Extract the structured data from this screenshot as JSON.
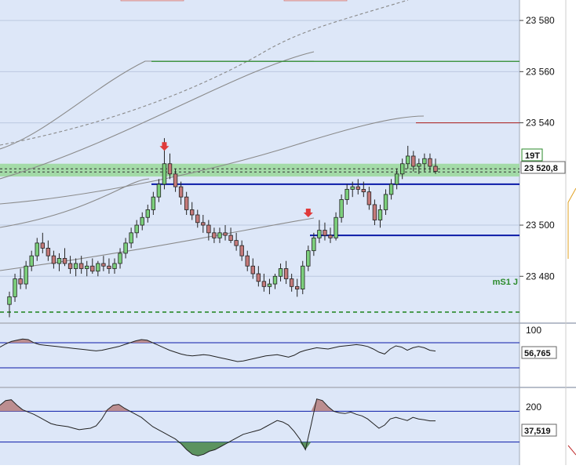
{
  "colors": {
    "pane_bg": "#dde7f8",
    "axis_bg": "#ffffff",
    "grid": "#bcc8e0",
    "candle_up": "#7ccf7c",
    "candle_down": "#c47a7a",
    "level_blue": "#0a1aa8",
    "zone_green": "#9ad89a",
    "indicator_line": "#222222",
    "indicator_fill": "#b88484",
    "indicator_fill_low": "#4e8a4e",
    "marker_red": "#e03a3a",
    "level_dkgreen": "#2a8a2a",
    "resistance_red": "#b03030"
  },
  "main_axis": {
    "ticks": [
      "23 580",
      "23 560",
      "23 540",
      "23 500",
      "23 480"
    ]
  },
  "labels": {
    "price_box": "23 520,8",
    "period_box": "19T",
    "level_tag": "mS1 J"
  },
  "rsi_axis": {
    "tick": "100",
    "value_box": "56,765"
  },
  "cci_axis": {
    "tick": "200",
    "value_box": "37,519"
  },
  "chart_data": [
    {
      "type": "candlestick",
      "ylim": [
        23462,
        23588
      ],
      "yticks": [
        23580,
        23560,
        23540,
        23500,
        23480
      ],
      "grid": true,
      "last_price": 23520.8,
      "levels": [
        {
          "value": 23516,
          "color": "level_blue"
        },
        {
          "value": 23496,
          "color": "level_blue"
        },
        {
          "value": 23466,
          "color": "level_dkgreen",
          "style": "dashed"
        },
        {
          "value": 23540,
          "color": "resistance_red"
        },
        {
          "value": 23564,
          "color": "level_dkgreen"
        }
      ],
      "zone": [
        23519,
        23524
      ],
      "candles": [
        [
          23469,
          23474,
          23464,
          23472
        ],
        [
          23472,
          23481,
          23470,
          23479
        ],
        [
          23479,
          23483,
          23475,
          23477
        ],
        [
          23477,
          23486,
          23475,
          23484
        ],
        [
          23484,
          23490,
          23482,
          23488
        ],
        [
          23488,
          23495,
          23486,
          23493
        ],
        [
          23493,
          23497,
          23489,
          23491
        ],
        [
          23491,
          23494,
          23486,
          23488
        ],
        [
          23488,
          23490,
          23483,
          23485
        ],
        [
          23485,
          23489,
          23482,
          23487
        ],
        [
          23487,
          23491,
          23484,
          23485
        ],
        [
          23485,
          23488,
          23481,
          23483
        ],
        [
          23483,
          23487,
          23480,
          23485
        ],
        [
          23485,
          23488,
          23481,
          23483
        ],
        [
          23483,
          23486,
          23480,
          23484
        ],
        [
          23484,
          23487,
          23481,
          23482
        ],
        [
          23482,
          23486,
          23480,
          23485
        ],
        [
          23485,
          23488,
          23482,
          23484
        ],
        [
          23484,
          23487,
          23481,
          23483
        ],
        [
          23483,
          23487,
          23481,
          23485
        ],
        [
          23485,
          23491,
          23483,
          23489
        ],
        [
          23489,
          23495,
          23487,
          23493
        ],
        [
          23493,
          23499,
          23491,
          23497
        ],
        [
          23497,
          23502,
          23495,
          23500
        ],
        [
          23500,
          23505,
          23498,
          23503
        ],
        [
          23503,
          23508,
          23501,
          23506
        ],
        [
          23506,
          23513,
          23504,
          23511
        ],
        [
          23511,
          23518,
          23509,
          23516
        ],
        [
          23516,
          23534,
          23514,
          23524
        ],
        [
          23524,
          23528,
          23518,
          23520
        ],
        [
          23520,
          23522,
          23513,
          23515
        ],
        [
          23515,
          23517,
          23508,
          23511
        ],
        [
          23511,
          23513,
          23504,
          23506
        ],
        [
          23506,
          23509,
          23502,
          23504
        ],
        [
          23504,
          23506,
          23499,
          23501
        ],
        [
          23501,
          23504,
          23497,
          23500
        ],
        [
          23500,
          23502,
          23494,
          23497
        ],
        [
          23497,
          23499,
          23493,
          23495
        ],
        [
          23495,
          23499,
          23493,
          23497
        ],
        [
          23497,
          23500,
          23494,
          23496
        ],
        [
          23496,
          23499,
          23493,
          23494
        ],
        [
          23494,
          23497,
          23490,
          23492
        ],
        [
          23492,
          23494,
          23486,
          23488
        ],
        [
          23488,
          23490,
          23482,
          23484
        ],
        [
          23484,
          23487,
          23479,
          23481
        ],
        [
          23481,
          23484,
          23476,
          23478
        ],
        [
          23478,
          23481,
          23474,
          23476
        ],
        [
          23476,
          23479,
          23473,
          23477
        ],
        [
          23477,
          23481,
          23475,
          23480
        ],
        [
          23480,
          23485,
          23478,
          23483
        ],
        [
          23483,
          23486,
          23477,
          23479
        ],
        [
          23479,
          23481,
          23474,
          23476
        ],
        [
          23476,
          23479,
          23472,
          23475
        ],
        [
          23475,
          23486,
          23473,
          23484
        ],
        [
          23484,
          23492,
          23482,
          23490
        ],
        [
          23490,
          23497,
          23488,
          23495
        ],
        [
          23495,
          23502,
          23493,
          23498
        ],
        [
          23498,
          23501,
          23494,
          23496
        ],
        [
          23496,
          23499,
          23493,
          23495
        ],
        [
          23495,
          23505,
          23494,
          23503
        ],
        [
          23503,
          23512,
          23501,
          23510
        ],
        [
          23510,
          23516,
          23508,
          23514
        ],
        [
          23514,
          23517,
          23511,
          23515
        ],
        [
          23515,
          23518,
          23512,
          23514
        ],
        [
          23514,
          23517,
          23511,
          23513
        ],
        [
          23513,
          23515,
          23506,
          23508
        ],
        [
          23508,
          23510,
          23500,
          23502
        ],
        [
          23502,
          23508,
          23499,
          23506
        ],
        [
          23506,
          23514,
          23504,
          23512
        ],
        [
          23512,
          23518,
          23510,
          23516
        ],
        [
          23516,
          23522,
          23514,
          23520
        ],
        [
          23520,
          23526,
          23518,
          23524
        ],
        [
          23524,
          23531,
          23522,
          23527
        ],
        [
          23527,
          23529,
          23521,
          23523
        ],
        [
          23523,
          23526,
          23520,
          23524
        ],
        [
          23524,
          23528,
          23521,
          23526
        ],
        [
          23526,
          23528,
          23521,
          23523
        ],
        [
          23523,
          23526,
          23520,
          23521
        ]
      ]
    },
    {
      "type": "line",
      "ylim": [
        0,
        100
      ],
      "ref_lines": [
        70,
        30
      ],
      "last_value": 56.765,
      "values": [
        63,
        68,
        72,
        74,
        76,
        75,
        70,
        67,
        66,
        65,
        64,
        63,
        62,
        61,
        60,
        59,
        58,
        57,
        58,
        60,
        62,
        64,
        67,
        70,
        73,
        75,
        74,
        70,
        66,
        62,
        58,
        55,
        52,
        50,
        49,
        50,
        51,
        50,
        48,
        46,
        44,
        42,
        40,
        41,
        43,
        45,
        47,
        49,
        50,
        51,
        49,
        47,
        50,
        55,
        58,
        60,
        62,
        61,
        60,
        62,
        64,
        65,
        66,
        67,
        66,
        64,
        60,
        55,
        52,
        60,
        65,
        63,
        58,
        62,
        64,
        62,
        58,
        56.765
      ]
    },
    {
      "type": "line",
      "ylim": [
        -250,
        250
      ],
      "ref_lines": [
        100,
        -100
      ],
      "last_value": 37.519,
      "values": [
        140,
        170,
        175,
        140,
        110,
        95,
        80,
        60,
        40,
        20,
        10,
        5,
        0,
        -10,
        -20,
        -15,
        -10,
        5,
        50,
        110,
        140,
        145,
        120,
        100,
        80,
        60,
        30,
        0,
        -20,
        -40,
        -60,
        -80,
        -110,
        -150,
        -180,
        -190,
        -180,
        -160,
        -150,
        -130,
        -110,
        -90,
        -70,
        -50,
        -40,
        -30,
        -20,
        0,
        20,
        40,
        30,
        10,
        -30,
        -80,
        -150,
        10,
        180,
        170,
        130,
        100,
        90,
        85,
        95,
        80,
        70,
        50,
        20,
        -10,
        10,
        50,
        60,
        50,
        40,
        60,
        50,
        45,
        38,
        37.519
      ]
    }
  ]
}
